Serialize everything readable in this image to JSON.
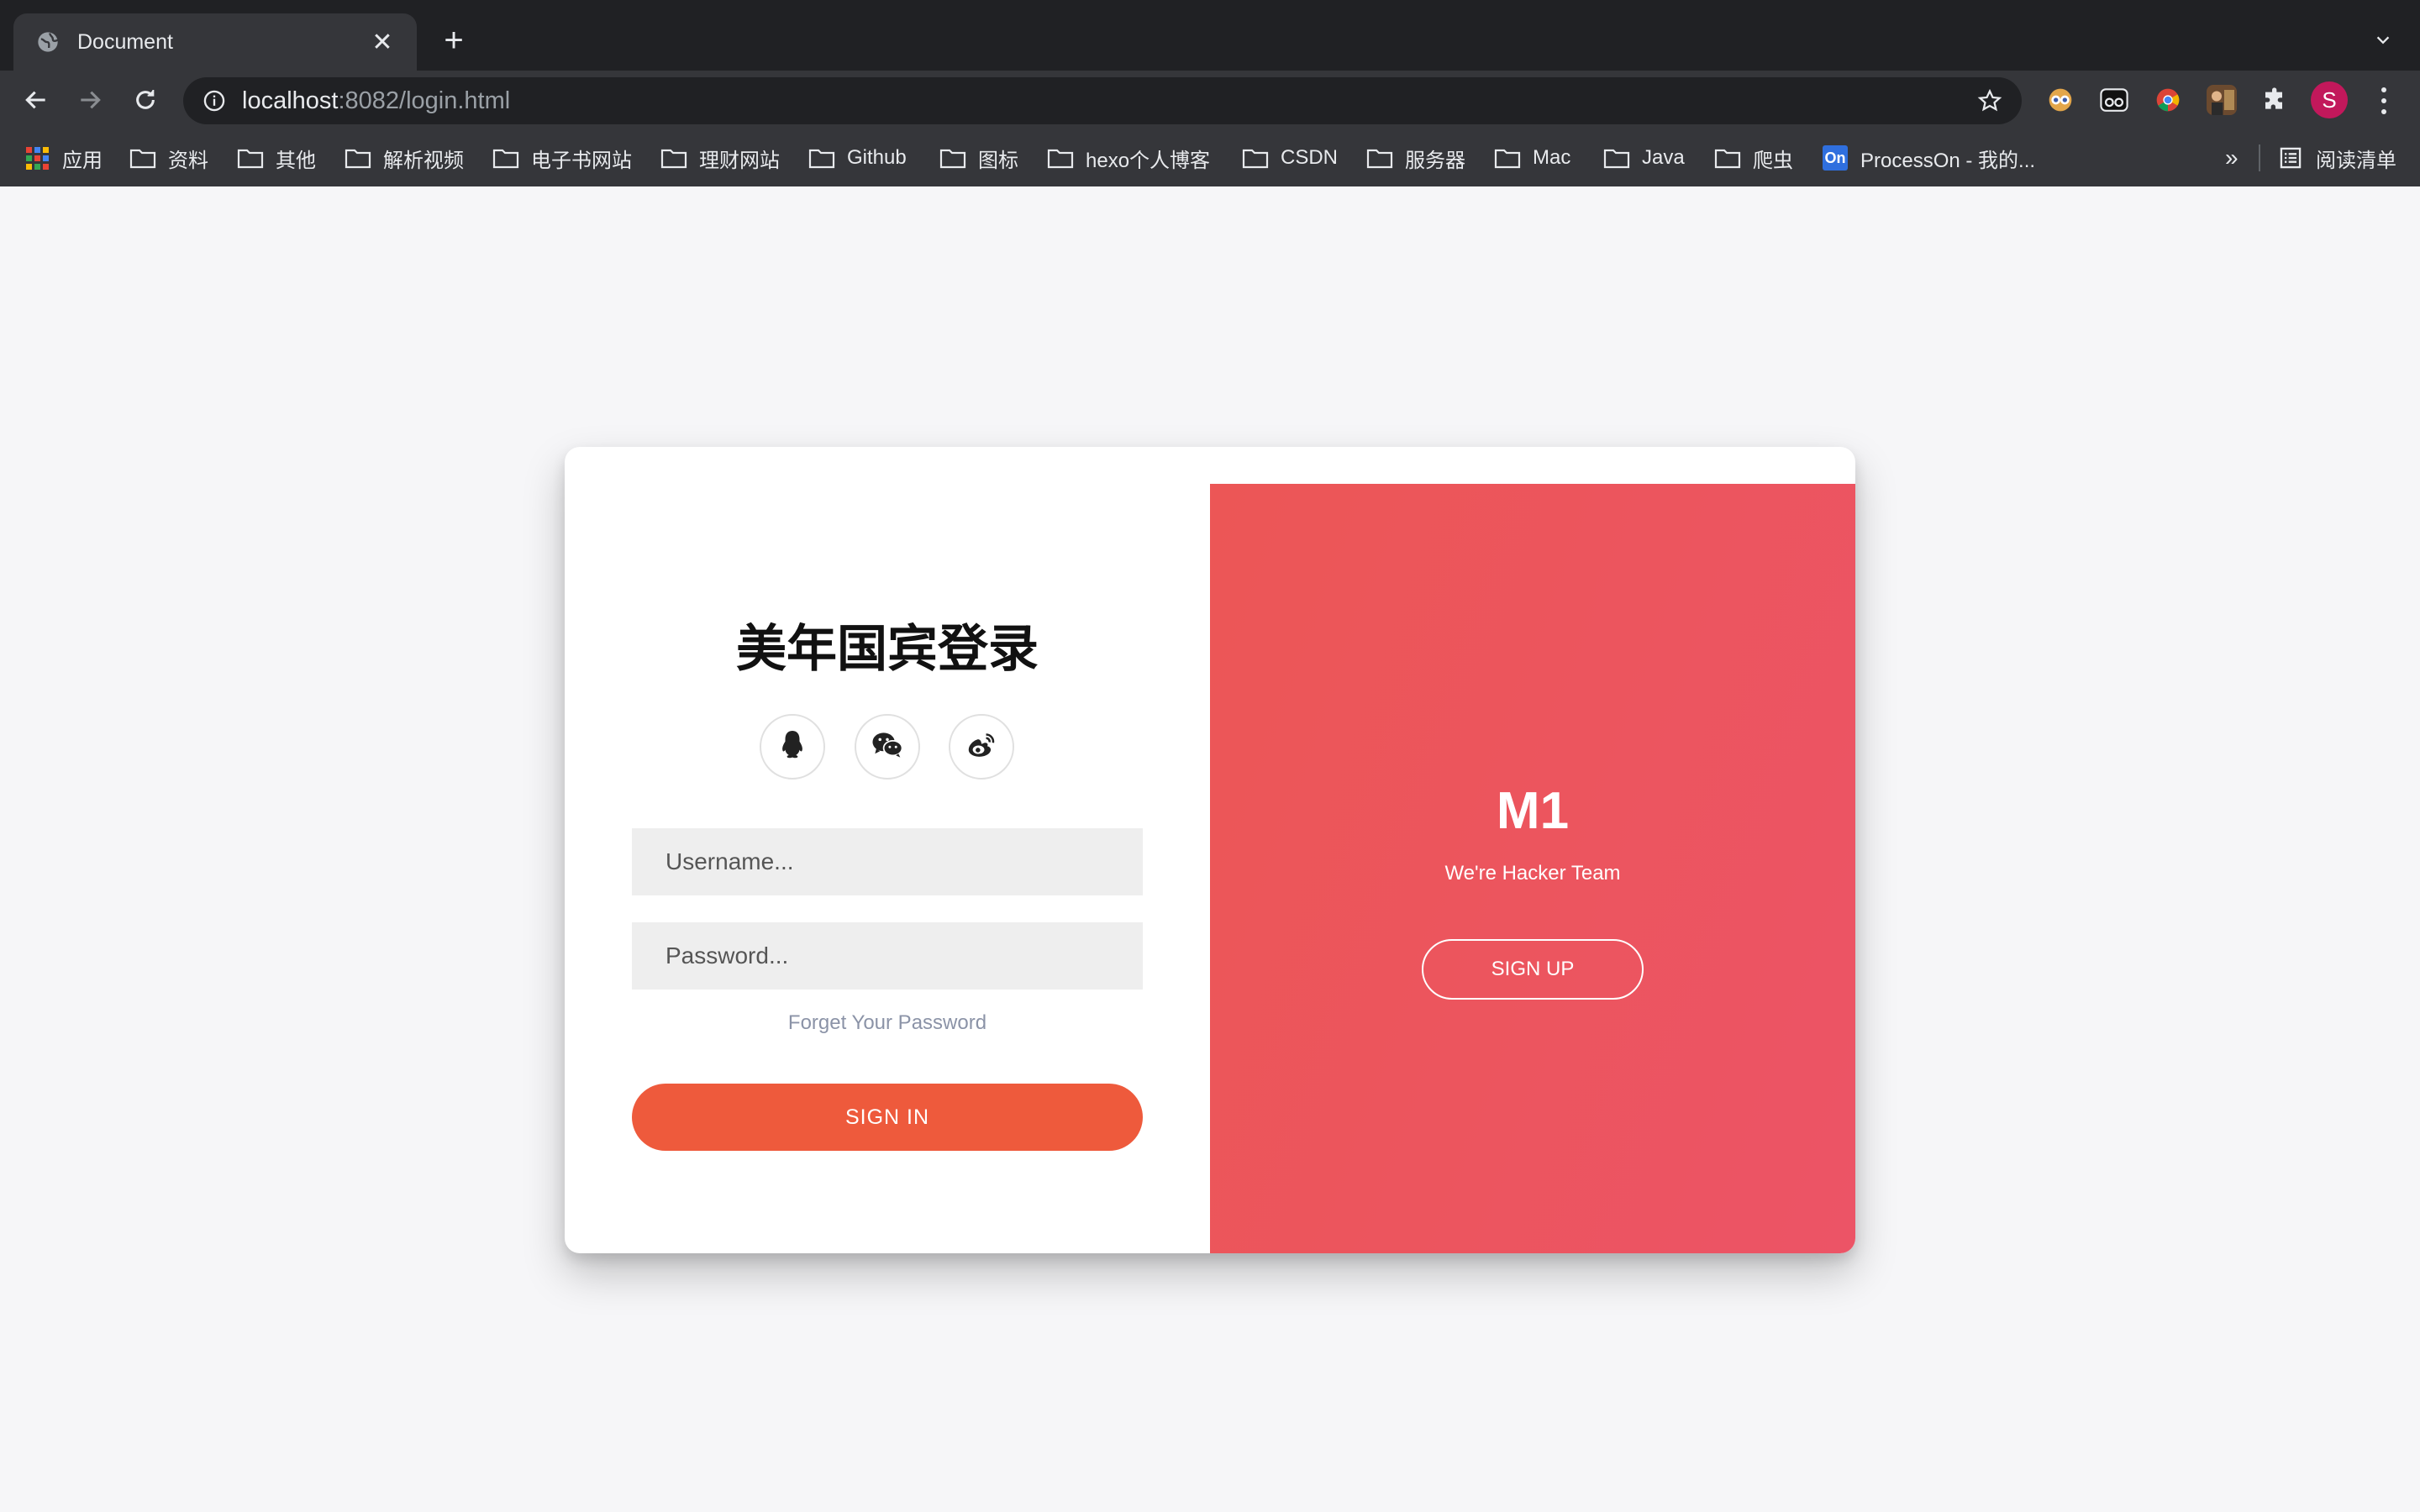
{
  "browser": {
    "tab_title": "Document",
    "tab_close": "✕",
    "new_tab": "+",
    "url_host": "localhost",
    "url_rest": ":8082/login.html",
    "profile_initial": "S"
  },
  "bookmarks": {
    "items": [
      {
        "label": "应用",
        "icon": "apps-grid-icon"
      },
      {
        "label": "资料",
        "icon": "folder-icon"
      },
      {
        "label": "其他",
        "icon": "folder-icon"
      },
      {
        "label": "解析视频",
        "icon": "folder-icon"
      },
      {
        "label": "电子书网站",
        "icon": "folder-icon"
      },
      {
        "label": "理财网站",
        "icon": "folder-icon"
      },
      {
        "label": "Github",
        "icon": "folder-icon"
      },
      {
        "label": "图标",
        "icon": "folder-icon"
      },
      {
        "label": "hexo个人博客",
        "icon": "folder-icon"
      },
      {
        "label": "CSDN",
        "icon": "folder-icon"
      },
      {
        "label": "服务器",
        "icon": "folder-icon"
      },
      {
        "label": "Mac",
        "icon": "folder-icon"
      },
      {
        "label": "Java",
        "icon": "folder-icon"
      },
      {
        "label": "爬虫",
        "icon": "folder-icon"
      },
      {
        "label": "ProcessOn - 我的...",
        "icon": "processon-icon",
        "badge": "On"
      }
    ],
    "more": "»",
    "reading_list": "阅读清单"
  },
  "login": {
    "title": "美年国宾登录",
    "social": [
      "qq-icon",
      "wechat-icon",
      "weibo-icon"
    ],
    "username_placeholder": "Username...",
    "password_placeholder": "Password...",
    "forgot": "Forget Your Password",
    "signin": "SIGN IN"
  },
  "promo": {
    "brand": "M1",
    "tagline": "We're Hacker Team",
    "signup": "SIGN UP"
  },
  "colors": {
    "signin_button": "#ee5a3c",
    "promo_gradient_start": "#ec5656",
    "promo_gradient_end": "#ec5466",
    "page_background": "#f6f6f8"
  }
}
